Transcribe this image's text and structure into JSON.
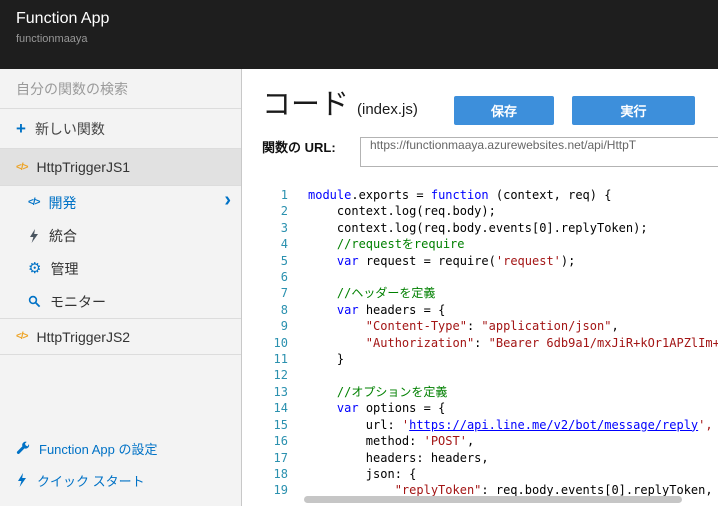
{
  "header": {
    "app_title": "Function App",
    "app_subtitle": "functionmaaya"
  },
  "sidebar": {
    "search_placeholder": "自分の関数の検索",
    "new_function": "新しい関数",
    "function1": "HttpTriggerJS1",
    "function2": "HttpTriggerJS2",
    "subitems": {
      "develop": "開発",
      "integrate": "統合",
      "manage": "管理",
      "monitor": "モニター"
    },
    "footer": {
      "settings": "Function App の設定",
      "quickstart": "クイック スタート"
    }
  },
  "main": {
    "title": "コード",
    "subtitle": "(index.js)",
    "save_button": "保存",
    "run_button": "実行",
    "url_label": "関数の URL:",
    "url_value": "https://functionmaaya.azurewebsites.net/api/HttpT"
  },
  "icons": {
    "plus": "+",
    "function_glyph": "</>",
    "develop_glyph": "</>",
    "gear": "⚙",
    "chevron": "›"
  },
  "colors": {
    "accent_blue": "#0072c6",
    "button_blue": "#3d8fdb",
    "keyword": "#0000ff",
    "string": "#a31515",
    "comment": "#008000",
    "line_number": "#2b91af"
  },
  "editor": {
    "lines": [
      [
        [
          "b",
          "module"
        ],
        [
          "d",
          ".exports = "
        ],
        [
          "b",
          "function"
        ],
        [
          "d",
          " (context, req) {"
        ]
      ],
      [
        [
          "d",
          "    context.log(req.body);"
        ]
      ],
      [
        [
          "d",
          "    context.log(req.body.events[0].replyToken);"
        ]
      ],
      [
        [
          "c",
          "    //requestをrequire"
        ]
      ],
      [
        [
          "d",
          "    "
        ],
        [
          "b",
          "var"
        ],
        [
          "d",
          " request = require("
        ],
        [
          "s",
          "'request'"
        ],
        [
          "d",
          ");"
        ]
      ],
      [],
      [
        [
          "c",
          "    //ヘッダーを定義"
        ]
      ],
      [
        [
          "d",
          "    "
        ],
        [
          "b",
          "var"
        ],
        [
          "d",
          " headers = {"
        ]
      ],
      [
        [
          "d",
          "        "
        ],
        [
          "s",
          "\"Content-Type\""
        ],
        [
          "d",
          ": "
        ],
        [
          "s",
          "\"application/json\""
        ],
        [
          "d",
          ","
        ]
      ],
      [
        [
          "d",
          "        "
        ],
        [
          "s",
          "\"Authorization\""
        ],
        [
          "d",
          ": "
        ],
        [
          "s",
          "\"Bearer 6db9a1/mxJiR+kOr1APZlIm+"
        ]
      ],
      [
        [
          "d",
          "    }"
        ]
      ],
      [],
      [
        [
          "c",
          "    //オプションを定義"
        ]
      ],
      [
        [
          "d",
          "    "
        ],
        [
          "b",
          "var"
        ],
        [
          "d",
          " options = {"
        ]
      ],
      [
        [
          "d",
          "        url: "
        ],
        [
          "s",
          "'"
        ],
        [
          "u",
          "https://api.line.me/v2/bot/message/reply"
        ],
        [
          "s",
          "',"
        ]
      ],
      [
        [
          "d",
          "        method: "
        ],
        [
          "s",
          "'POST'"
        ],
        [
          "d",
          ","
        ]
      ],
      [
        [
          "d",
          "        headers: headers,"
        ]
      ],
      [
        [
          "d",
          "        json: {"
        ]
      ],
      [
        [
          "d",
          "            "
        ],
        [
          "s",
          "\"replyToken\""
        ],
        [
          "d",
          ": req.body.events[0].replyToken,"
        ]
      ]
    ]
  }
}
